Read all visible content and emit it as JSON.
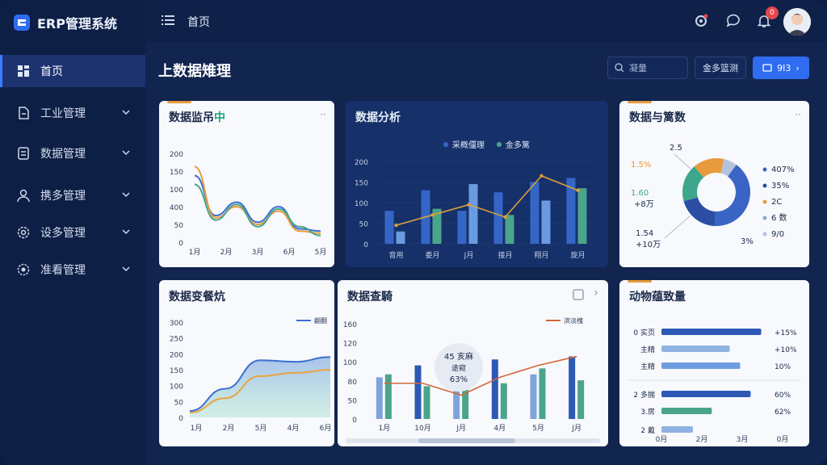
{
  "app": {
    "title": "ERP管理系统"
  },
  "header": {
    "breadcrumb": "首页",
    "notification_count": "0"
  },
  "sidebar": {
    "items": [
      {
        "label": "首页",
        "icon": "dashboard-icon",
        "active": true
      },
      {
        "label": "工业管理",
        "icon": "document-icon"
      },
      {
        "label": "数据管理",
        "icon": "database-icon"
      },
      {
        "label": "携多管理",
        "icon": "user-icon"
      },
      {
        "label": "设多管理",
        "icon": "settings-icon"
      },
      {
        "label": "准看管理",
        "icon": "gear-icon"
      }
    ]
  },
  "main": {
    "page_title": "上数据雉理",
    "search_placeholder": "凝量",
    "ghost_button": "金多篮测",
    "primary_button": "9I3"
  },
  "cards": {
    "c1": {
      "title_prefix": "数据监吊",
      "title_suffix": "中",
      "more": "··"
    },
    "c2": {
      "title": "数据分析",
      "legend": [
        "采概僵理",
        "金多篱"
      ]
    },
    "c3": {
      "title": "数据与篱数",
      "more": "··",
      "left_labels": [
        "2.5",
        "1.5%",
        "1.60",
        "+8万",
        "1.54",
        "+10万"
      ],
      "right_labels": [
        "407%",
        "35%",
        "2C",
        "6 数",
        "9/0"
      ],
      "bottom_label": "3%"
    },
    "c4": {
      "title": "数据变餐炕",
      "legend": "翩翻"
    },
    "c5": {
      "title": "数据查騎",
      "legend": "滨淡槐",
      "tooltip_line1": "45 亥麻",
      "tooltip_line2": "途窥",
      "tooltip_line3": "63%"
    },
    "c6": {
      "title": "动物蕴致量"
    }
  },
  "chart_data": [
    {
      "type": "line",
      "title": "数据监吊中",
      "ylim": [
        0,
        200
      ],
      "yticks": [
        "200",
        "150",
        "100",
        "400",
        "50",
        "0"
      ],
      "xticks": [
        "1月",
        "2月",
        "3月",
        "6月",
        "5月"
      ],
      "series": [
        {
          "color": "#3b6fd0",
          "values": [
            150,
            60,
            90,
            45,
            80,
            30,
            25
          ]
        },
        {
          "color": "#e89a3c",
          "values": [
            170,
            55,
            80,
            40,
            70,
            25,
            20
          ]
        },
        {
          "color": "#44a58c",
          "values": [
            130,
            50,
            85,
            35,
            75,
            35,
            15
          ]
        }
      ]
    },
    {
      "type": "bar",
      "title": "数据分析",
      "ylim": [
        0,
        200
      ],
      "yticks": [
        "200",
        "150",
        "100",
        "50",
        "0"
      ],
      "categories": [
        "音用",
        "娄月",
        "J月",
        "接月",
        "翔月",
        "旋月"
      ],
      "series": [
        {
          "name": "采概僵理",
          "color": "#3566c6",
          "values": [
            80,
            130,
            80,
            125,
            150,
            160
          ]
        },
        {
          "name": "金多篱",
          "color": "#4aa58a",
          "values": [
            30,
            85,
            145,
            70,
            105,
            135
          ]
        }
      ],
      "line": {
        "color": "#d9a03c",
        "values": [
          45,
          70,
          95,
          65,
          165,
          130
        ]
      }
    },
    {
      "type": "pie",
      "title": "数据与篱数",
      "values": [
        40.7,
        20,
        18,
        15,
        6.3
      ],
      "colors": [
        "#3b65c4",
        "#2c4fa3",
        "#3da68d",
        "#e89a3c",
        "#b3c2dd"
      ]
    },
    {
      "type": "area",
      "title": "数据变餐炕",
      "ylim": [
        0,
        300
      ],
      "yticks": [
        "300",
        "250",
        "200",
        "150",
        "100",
        "50",
        "0"
      ],
      "xticks": [
        "1月",
        "2月",
        "5月",
        "4月",
        "6月"
      ],
      "series": [
        {
          "name": "翩翻",
          "color": "#3b6fd0",
          "values": [
            20,
            90,
            180,
            175,
            190
          ]
        },
        {
          "color": "#e8a540",
          "values": [
            15,
            60,
            130,
            140,
            150
          ]
        }
      ]
    },
    {
      "type": "bar",
      "title": "数据查騎",
      "ylim": [
        0,
        160
      ],
      "yticks": [
        "160",
        "120",
        "100",
        "80",
        "50",
        "0"
      ],
      "categories": [
        "1月",
        "10月",
        "J月",
        "4月",
        "5月",
        "J月"
      ],
      "series": [
        {
          "color": "#3566c6",
          "values": [
            70,
            90,
            75,
            100,
            75,
            105
          ]
        },
        {
          "color": "#4aa58a",
          "values": [
            75,
            55,
            60,
            60,
            85,
            65
          ]
        }
      ],
      "line": {
        "name": "滨淡槐",
        "color": "#d4673c",
        "values": [
          60,
          60,
          40,
          70,
          90,
          105
        ]
      }
    },
    {
      "type": "hbar",
      "title": "动物蕴致量",
      "categories": [
        "0 实页",
        "主精",
        "主精",
        "2 多揣",
        "3.房",
        "2 戴"
      ],
      "values": [
        95,
        65,
        75,
        85,
        48,
        30
      ],
      "colors": [
        "#2d58b5",
        "#8fb2e3",
        "#6f9de0",
        "#2d58b5",
        "#4aa58a",
        "#8fb2e3"
      ],
      "right_labels": [
        "+15%",
        "+10%",
        "10%",
        "60%",
        "62%"
      ],
      "xticks": [
        "0月",
        "2月",
        "3月",
        "0月"
      ]
    }
  ]
}
